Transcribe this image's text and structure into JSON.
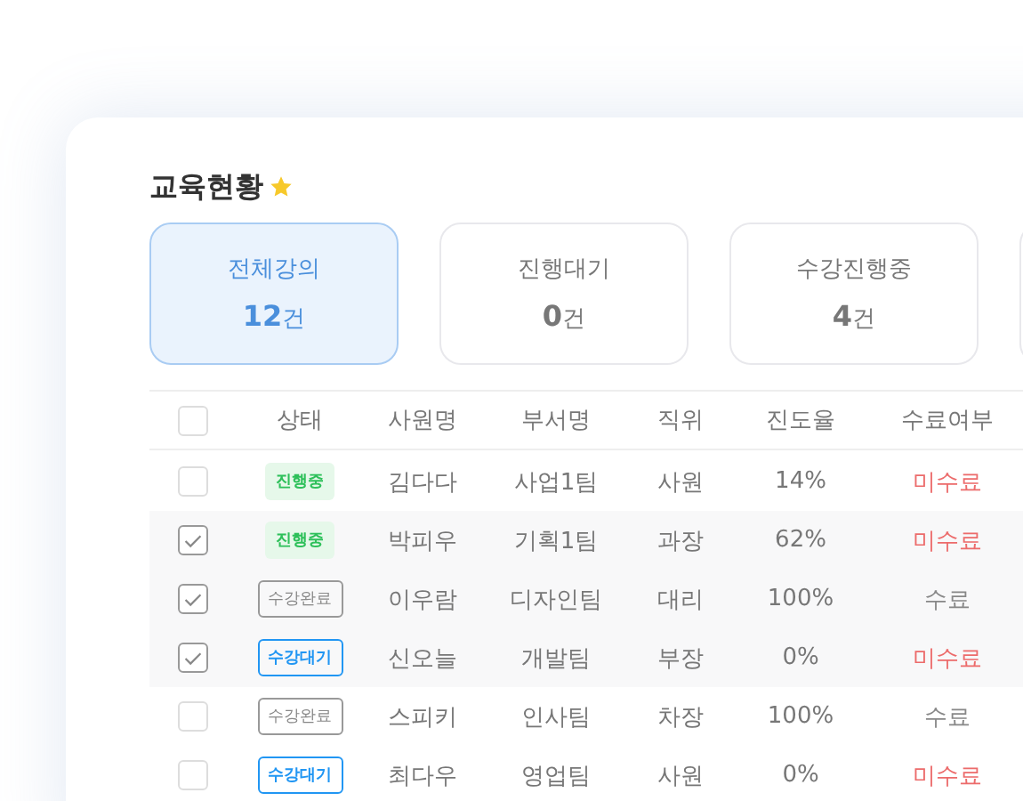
{
  "title": "교육현황",
  "summary": [
    {
      "label": "전체강의",
      "count": "12",
      "unit": "건",
      "selected": true
    },
    {
      "label": "진행대기",
      "count": "0",
      "unit": "건",
      "selected": false
    },
    {
      "label": "수강진행중",
      "count": "4",
      "unit": "건",
      "selected": false
    }
  ],
  "table": {
    "columns": [
      "상태",
      "사원명",
      "부서명",
      "직위",
      "진도율",
      "수료여부"
    ],
    "header_checked": false,
    "rows": [
      {
        "checked": false,
        "status": {
          "kind": "in_progress",
          "label": "진행중"
        },
        "name": "김다다",
        "dept": "사업1팀",
        "position": "사원",
        "progress": "14%",
        "completion": {
          "done": false,
          "label": "미수료"
        }
      },
      {
        "checked": true,
        "status": {
          "kind": "in_progress",
          "label": "진행중"
        },
        "name": "박피우",
        "dept": "기획1팀",
        "position": "과장",
        "progress": "62%",
        "completion": {
          "done": false,
          "label": "미수료"
        }
      },
      {
        "checked": true,
        "status": {
          "kind": "completed",
          "label": "수강완료"
        },
        "name": "이우람",
        "dept": "디자인팀",
        "position": "대리",
        "progress": "100%",
        "completion": {
          "done": true,
          "label": "수료"
        }
      },
      {
        "checked": true,
        "status": {
          "kind": "waiting",
          "label": "수강대기"
        },
        "name": "신오늘",
        "dept": "개발팀",
        "position": "부장",
        "progress": "0%",
        "completion": {
          "done": false,
          "label": "미수료"
        }
      },
      {
        "checked": false,
        "status": {
          "kind": "completed",
          "label": "수강완료"
        },
        "name": "스피키",
        "dept": "인사팀",
        "position": "차장",
        "progress": "100%",
        "completion": {
          "done": true,
          "label": "수료"
        }
      },
      {
        "checked": false,
        "status": {
          "kind": "waiting",
          "label": "수강대기"
        },
        "name": "최다우",
        "dept": "영업팀",
        "position": "사원",
        "progress": "0%",
        "completion": {
          "done": false,
          "label": "미수료"
        }
      }
    ]
  }
}
